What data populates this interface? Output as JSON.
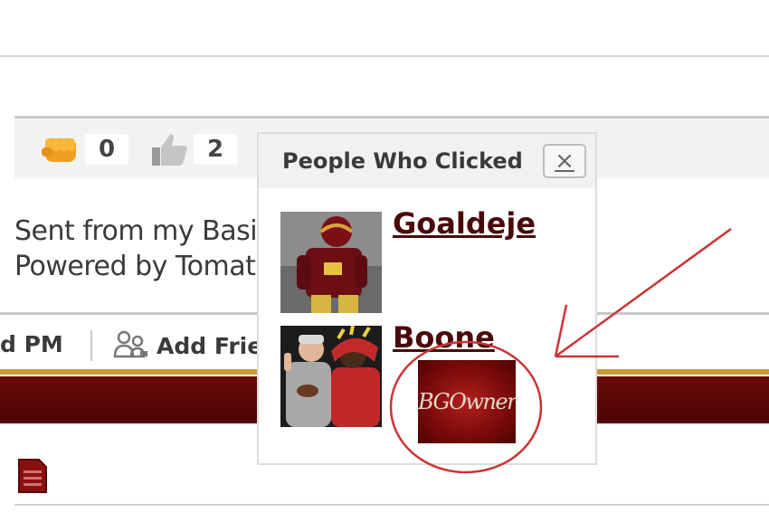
{
  "reactions": [
    {
      "icon": "fist-icon",
      "count": "0"
    },
    {
      "icon": "thumbs-up-icon",
      "count": "2"
    }
  ],
  "post": {
    "line1": "Sent from my Basic",
    "line2": "Powered by Tomato"
  },
  "actions": {
    "pm_label": "d PM",
    "add_friend_label": "Add Frie"
  },
  "popup": {
    "title": "People Who Clicked",
    "close_label": "×",
    "people": [
      {
        "name": "Goaldeje"
      },
      {
        "name": "Boone",
        "badge_text": "BGOwner"
      }
    ]
  },
  "colors": {
    "maroon": "#5a0606",
    "gold": "#c69b3a",
    "annotation_red": "#cc3333"
  }
}
